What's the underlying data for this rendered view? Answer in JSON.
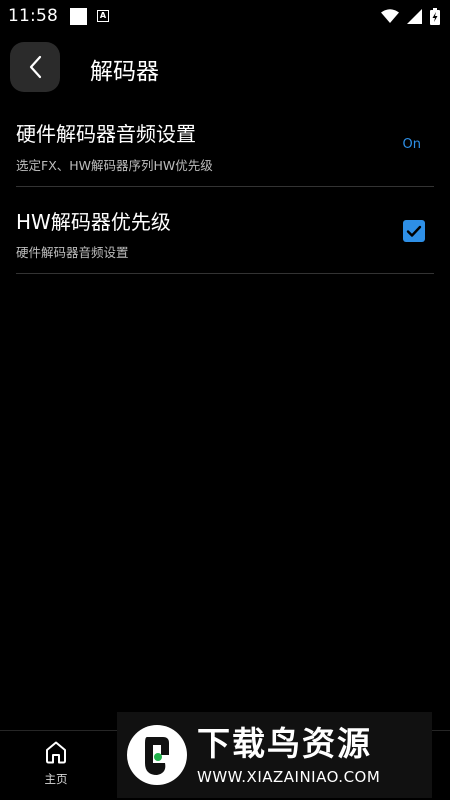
{
  "status_bar": {
    "time": "11:58",
    "icons": [
      "notification-square-icon",
      "a-notification-icon",
      "wifi-icon",
      "signal-icon",
      "battery-charging-icon"
    ]
  },
  "header": {
    "back_icon": "chevron-left-icon",
    "title": "解码器"
  },
  "settings": [
    {
      "title": "硬件解码器音频设置",
      "subtitle": "选定FX、HW解码器序列HW优先级",
      "value": "On"
    },
    {
      "title": "HW解码器优先级",
      "subtitle": "硬件解码器音频设置",
      "checked": true
    }
  ],
  "bottom_nav": {
    "items": [
      {
        "label": "主页",
        "icon": "home-icon"
      }
    ]
  },
  "watermark": {
    "text": "下载鸟资源",
    "url": "WWW.XIAZAINIAO.COM"
  },
  "colors": {
    "background": "#000000",
    "accent": "#2e8fe6",
    "divider": "#333333",
    "back_button_bg": "#2b2b2b"
  }
}
